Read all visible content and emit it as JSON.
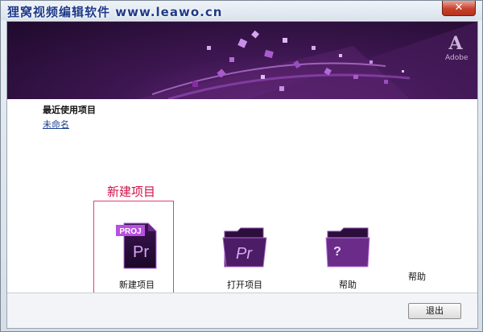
{
  "window": {
    "title": "狸窝视频编辑软件 www.leawo.cn",
    "close_symbol": "✕"
  },
  "banner": {
    "logo_text": "Adobe"
  },
  "recent": {
    "heading": "最近使用项目",
    "items": [
      "未命名"
    ]
  },
  "annotation": {
    "label": "新建项目"
  },
  "actions": {
    "new_project": {
      "label": "新建项目",
      "icon": "premiere-project-file-icon",
      "badge": "PROJ",
      "mark": "Pr"
    },
    "open_project": {
      "label": "打开项目",
      "icon": "premiere-folder-icon",
      "mark": "Pr"
    },
    "help": {
      "label": "帮助",
      "icon": "help-folder-icon",
      "mark": "?"
    },
    "help_ghost": "帮助"
  },
  "footer": {
    "exit_label": "退出"
  },
  "colors": {
    "accent_purple": "#8a2aa6",
    "annotation_red": "#d0104a"
  }
}
